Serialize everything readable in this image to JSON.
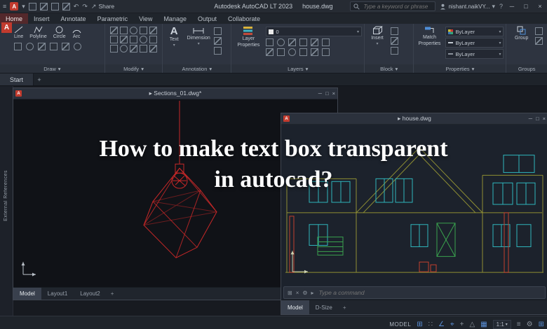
{
  "glyphs": {
    "caret": "▾",
    "doc": "▸",
    "min": "─",
    "max": "□",
    "close": "×",
    "help": "?",
    "menu": "≡",
    "undo": "↶",
    "redo": "↷",
    "share_arrow": "↗"
  },
  "titlebar": {
    "logo": "A",
    "app_name": "Autodesk AutoCAD LT 2023",
    "doc_name": "house.dwg",
    "share": "Share",
    "search_placeholder": "Type a keyword or phrase",
    "user": "nishant.naikVY..."
  },
  "tabs": {
    "items": [
      "Home",
      "Insert",
      "Annotate",
      "Parametric",
      "View",
      "Manage",
      "Output",
      "Collaborate"
    ]
  },
  "ribbon": {
    "draw": {
      "label": "Draw",
      "line": "Line",
      "polyline": "Polyline",
      "circle": "Circle",
      "arc": "Arc"
    },
    "modify": {
      "label": "Modify"
    },
    "annotation": {
      "label": "Annotation",
      "big_a": "A",
      "text": "Text",
      "dimension": "Dimension"
    },
    "layers": {
      "label": "Layers",
      "big1": "Layer",
      "big2": "Properties",
      "layer_value": "0"
    },
    "block": {
      "label": "Block",
      "insert": "Insert"
    },
    "properties": {
      "label": "Properties",
      "match1": "Match",
      "match2": "Properties",
      "bylayer": "ByLayer"
    },
    "groups": {
      "label": "Groups",
      "group": "Group"
    }
  },
  "file_tabs": {
    "start": "Start",
    "add": "+"
  },
  "canvas": {
    "side_label": "External References",
    "overlay_line1": "How to make text box transparent",
    "overlay_line2": "in autocad?",
    "sections_window": {
      "title": "Sections_01.dwg*",
      "model": "Model",
      "layout1": "Layout1",
      "layout2": "Layout2",
      "add": "+"
    },
    "house_window": {
      "title": "house.dwg",
      "command_placeholder": "Type a command",
      "model": "Model",
      "dsize": "D-Size",
      "add": "+",
      "cmd_icons": [
        "⊞",
        "×",
        "⚙"
      ]
    }
  },
  "statusbar": {
    "model": "MODEL",
    "scale": "1:1",
    "icons": [
      "⊞",
      "∷",
      "∠",
      "⌖",
      "+",
      "△",
      "▦"
    ],
    "icons2": [
      "≡",
      "⚙",
      "⊞"
    ]
  }
}
